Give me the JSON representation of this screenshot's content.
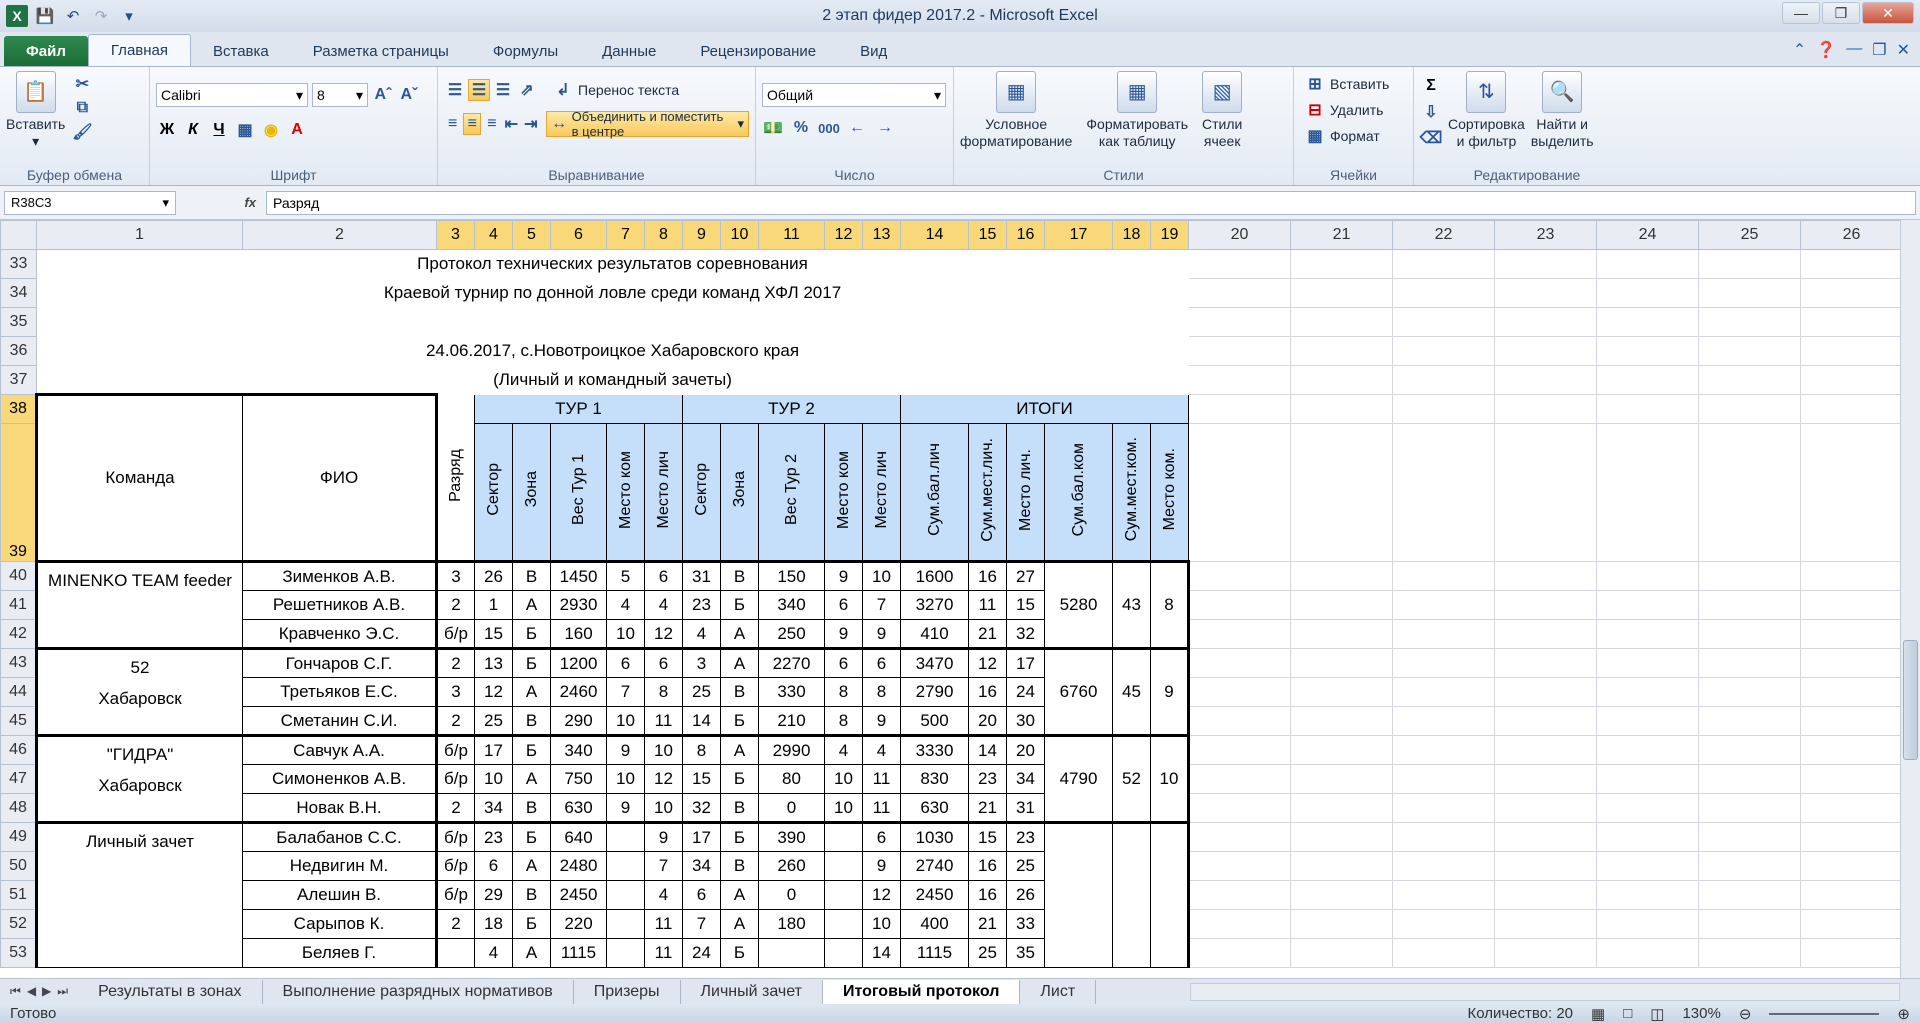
{
  "window": {
    "title": "2 этап фидер 2017.2 - Microsoft Excel"
  },
  "qat": {
    "save": "save-icon",
    "undo": "undo-icon",
    "redo": "redo-icon"
  },
  "tabs": [
    {
      "label": "Файл"
    },
    {
      "label": "Главная"
    },
    {
      "label": "Вставка"
    },
    {
      "label": "Разметка страницы"
    },
    {
      "label": "Формулы"
    },
    {
      "label": "Данные"
    },
    {
      "label": "Рецензирование"
    },
    {
      "label": "Вид"
    }
  ],
  "ribbon": {
    "clipboard": {
      "paste": "Вставить",
      "label": "Буфер обмена"
    },
    "font": {
      "name": "Calibri",
      "size": "8",
      "label": "Шрифт",
      "bold": "Ж",
      "italic": "К",
      "underline": "Ч"
    },
    "alignment": {
      "wrap": "Перенос текста",
      "merge": "Объединить и поместить в центре",
      "label": "Выравнивание"
    },
    "number": {
      "format": "Общий",
      "percent": "%",
      "thousands": "000",
      "label": "Число"
    },
    "styles": {
      "conditional": "Условное",
      "conditional2": "форматирование",
      "astable": "Форматировать",
      "astable2": "как таблицу",
      "cellstyles": "Стили",
      "cellstyles2": "ячеек",
      "label": "Стили"
    },
    "cells": {
      "insert": "Вставить",
      "delete": "Удалить",
      "format": "Формат",
      "label": "Ячейки"
    },
    "editing": {
      "sort": "Сортировка",
      "sort2": "и фильтр",
      "find": "Найти и",
      "find2": "выделить",
      "label": "Редактирование"
    }
  },
  "formula_bar": {
    "name_box": "R38C3",
    "fx": "fx",
    "content": "Разряд"
  },
  "sheet": {
    "col_headers": [
      "1",
      "2",
      "3",
      "4",
      "5",
      "6",
      "7",
      "8",
      "9",
      "10",
      "11",
      "12",
      "13",
      "14",
      "15",
      "16",
      "17",
      "18",
      "19",
      "20",
      "21",
      "22",
      "23",
      "24",
      "25",
      "26"
    ],
    "title_rows": {
      "r33": "Протокол технических результатов соревнования",
      "r34": "Краевой турнир по донной ловле среди команд ХФЛ 2017",
      "r36": "24.06.2017, с.Новотроицкое Хабаровского края",
      "r37": "(Личный и командный зачеты)"
    },
    "header": {
      "team": "Команда",
      "fio": "ФИО",
      "rank": "Разряд",
      "tour1": "ТУР 1",
      "tour2": "ТУР 2",
      "totals": "ИТОГИ",
      "sector": "Сектор",
      "zone": "Зона",
      "weight1": "Вес Тур 1",
      "place_team": "Место ком",
      "place_pers": "Место лич",
      "weight2": "Вес Тур 2",
      "sum_pts": "Сум.бал.лич",
      "sum_places": "Сум.мест.лич.",
      "place_final": "Место лич.",
      "team_pts": "Сум.бал.ком",
      "team_places": "Сум.мест.ком.",
      "team_place": "Место ком."
    },
    "teams": [
      {
        "name1": "MINENKO TEAM feeder",
        "name2": "",
        "team_pts": "5280",
        "team_places": "43",
        "team_place": "8",
        "rows": [
          {
            "row": "40",
            "fio": "Зименков А.В.",
            "c": [
              "3",
              "26",
              "В",
              "1450",
              "5",
              "6",
              "31",
              "В",
              "150",
              "9",
              "10",
              "1600",
              "16",
              "27"
            ]
          },
          {
            "row": "41",
            "fio": "Решетников А.В.",
            "c": [
              "2",
              "1",
              "А",
              "2930",
              "4",
              "4",
              "23",
              "Б",
              "340",
              "6",
              "7",
              "3270",
              "11",
              "15"
            ]
          },
          {
            "row": "42",
            "fio": "Кравченко Э.С.",
            "c": [
              "б/р",
              "15",
              "Б",
              "160",
              "10",
              "12",
              "4",
              "А",
              "250",
              "9",
              "9",
              "410",
              "21",
              "32"
            ]
          }
        ]
      },
      {
        "name1": "52",
        "name2": "Хабаровск",
        "team_pts": "6760",
        "team_places": "45",
        "team_place": "9",
        "rows": [
          {
            "row": "43",
            "fio": "Гончаров С.Г.",
            "c": [
              "2",
              "13",
              "Б",
              "1200",
              "6",
              "6",
              "3",
              "А",
              "2270",
              "6",
              "6",
              "3470",
              "12",
              "17"
            ]
          },
          {
            "row": "44",
            "fio": "Третьяков Е.С.",
            "c": [
              "3",
              "12",
              "А",
              "2460",
              "7",
              "8",
              "25",
              "В",
              "330",
              "8",
              "8",
              "2790",
              "16",
              "24"
            ]
          },
          {
            "row": "45",
            "fio": "Сметанин С.И.",
            "c": [
              "2",
              "25",
              "В",
              "290",
              "10",
              "11",
              "14",
              "Б",
              "210",
              "8",
              "9",
              "500",
              "20",
              "30"
            ]
          }
        ]
      },
      {
        "name1": "\"ГИДРА\"",
        "name2": "Хабаровск",
        "team_pts": "4790",
        "team_places": "52",
        "team_place": "10",
        "rows": [
          {
            "row": "46",
            "fio": "Савчук А.А.",
            "c": [
              "б/р",
              "17",
              "Б",
              "340",
              "9",
              "10",
              "8",
              "А",
              "2990",
              "4",
              "4",
              "3330",
              "14",
              "20"
            ]
          },
          {
            "row": "47",
            "fio": "Симоненков А.В.",
            "c": [
              "б/р",
              "10",
              "А",
              "750",
              "10",
              "12",
              "15",
              "Б",
              "80",
              "10",
              "11",
              "830",
              "23",
              "34"
            ]
          },
          {
            "row": "48",
            "fio": "Новак В.Н.",
            "c": [
              "2",
              "34",
              "В",
              "630",
              "9",
              "10",
              "32",
              "В",
              "0",
              "10",
              "11",
              "630",
              "21",
              "31"
            ]
          }
        ]
      },
      {
        "name1": "Личный зачет",
        "name2": "",
        "team_pts": "",
        "team_places": "",
        "team_place": "",
        "rows": [
          {
            "row": "49",
            "fio": "Балабанов С.С.",
            "c": [
              "б/р",
              "23",
              "Б",
              "640",
              "",
              "9",
              "17",
              "Б",
              "390",
              "",
              "6",
              "1030",
              "15",
              "23"
            ]
          },
          {
            "row": "50",
            "fio": "Недвигин М.",
            "c": [
              "б/р",
              "6",
              "А",
              "2480",
              "",
              "7",
              "34",
              "В",
              "260",
              "",
              "9",
              "2740",
              "16",
              "25"
            ]
          },
          {
            "row": "51",
            "fio": "Алешин В.",
            "c": [
              "б/р",
              "29",
              "В",
              "2450",
              "",
              "4",
              "6",
              "А",
              "0",
              "",
              "12",
              "2450",
              "16",
              "26"
            ]
          },
          {
            "row": "52",
            "fio": "Сарыпов К.",
            "c": [
              "2",
              "18",
              "Б",
              "220",
              "",
              "11",
              "7",
              "А",
              "180",
              "",
              "10",
              "400",
              "21",
              "33"
            ]
          },
          {
            "row": "53",
            "fio": "Беляев Г.",
            "c": [
              "",
              "4",
              "А",
              "1115",
              "",
              "11",
              "24",
              "Б",
              "",
              "",
              "14",
              "1115",
              "25",
              "35"
            ]
          }
        ]
      }
    ]
  },
  "sheet_tabs": [
    {
      "label": "Результаты в зонах"
    },
    {
      "label": "Выполнение разрядных нормативов"
    },
    {
      "label": "Призеры"
    },
    {
      "label": "Личный зачет"
    },
    {
      "label": "Итоговый протокол"
    },
    {
      "label": "Лист"
    }
  ],
  "status": {
    "ready": "Готово",
    "count": "Количество: 20",
    "zoom": "130%"
  }
}
